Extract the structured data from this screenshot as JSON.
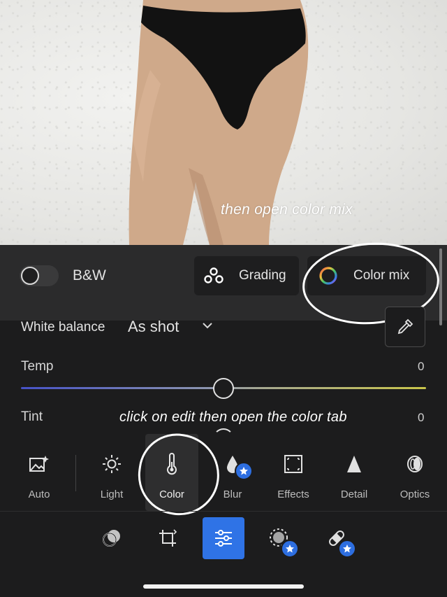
{
  "overlay": {
    "top_caption": "then open color mix",
    "mid_caption": "click on edit then open the color tab"
  },
  "profile_bar": {
    "bw_label": "B&W",
    "bw_enabled": false,
    "grading_label": "Grading",
    "color_mix_label": "Color mix"
  },
  "white_balance": {
    "label": "White balance",
    "value": "As shot"
  },
  "sliders": {
    "temp": {
      "label": "Temp",
      "value": "0"
    },
    "tint": {
      "label": "Tint",
      "value": "0"
    }
  },
  "tools": [
    {
      "label": "Auto",
      "icon": "auto-magic-image-icon",
      "premium": false
    },
    {
      "label": "Light",
      "icon": "sun-icon",
      "premium": false
    },
    {
      "label": "Color",
      "icon": "thermometer-icon",
      "premium": false,
      "active": true
    },
    {
      "label": "Blur",
      "icon": "droplet-icon",
      "premium": true
    },
    {
      "label": "Effects",
      "icon": "effects-frame-icon",
      "premium": false
    },
    {
      "label": "Detail",
      "icon": "triangle-icon",
      "premium": false
    },
    {
      "label": "Optics",
      "icon": "lens-icon",
      "premium": false
    }
  ],
  "bottom_nav": [
    {
      "icon": "presets-icon",
      "premium": false
    },
    {
      "icon": "crop-icon",
      "premium": false
    },
    {
      "icon": "edit-sliders-icon",
      "premium": false,
      "active": true
    },
    {
      "icon": "masking-icon",
      "premium": true
    },
    {
      "icon": "healing-bandage-icon",
      "premium": true
    }
  ],
  "colors": {
    "accent": "#2f73e6",
    "panel_bg": "#1c1c1d",
    "bar_bg": "#2b2b2c"
  }
}
